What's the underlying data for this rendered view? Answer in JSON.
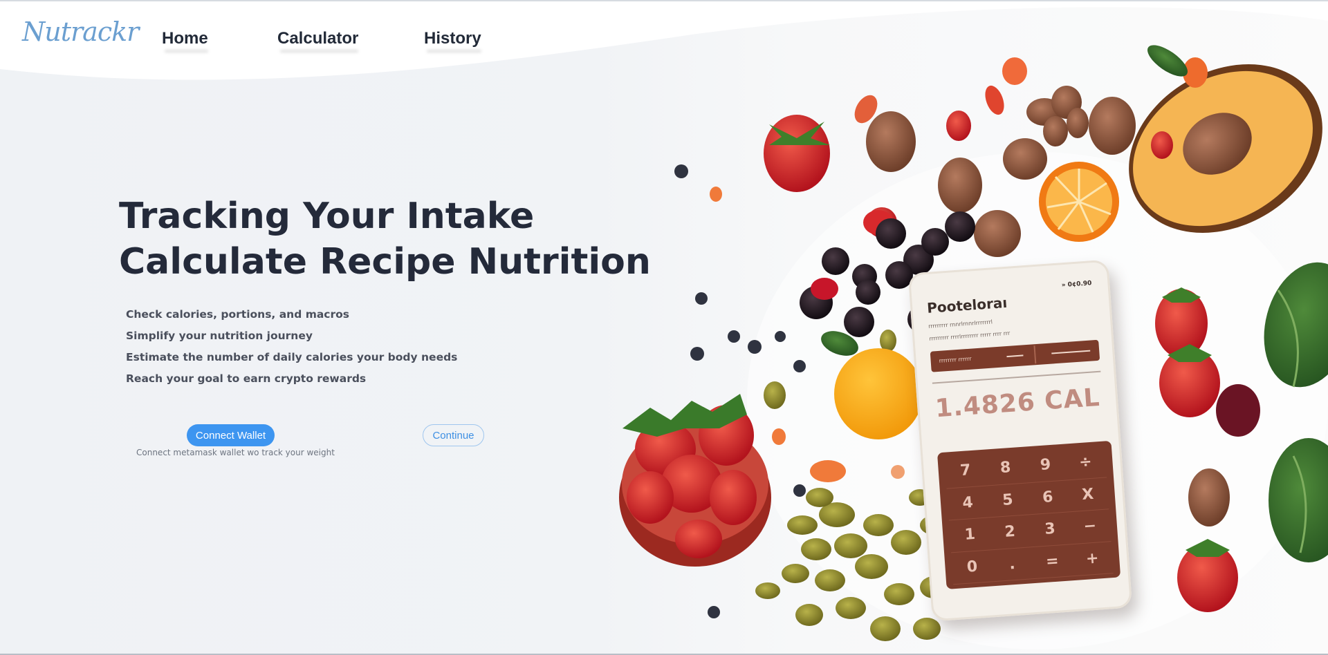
{
  "logo": {
    "text": "Nutrackr"
  },
  "nav": {
    "items": [
      {
        "label": "Home"
      },
      {
        "label": "Calculator"
      },
      {
        "label": "History"
      }
    ]
  },
  "hero": {
    "title_line1": "Tracking Your Intake",
    "title_line2": "Calculate Recipe Nutrition",
    "features": [
      "Check calories, portions, and macros",
      "Simplify your nutrition journey",
      "Estimate the number of daily calories your body needs",
      "Reach your goal to earn crypto rewards"
    ]
  },
  "actions": {
    "connect_label": "Connect Wallet",
    "continue_label": "Continue",
    "connect_hint": "Connect metamask wallet wo track your weight"
  },
  "illustration": {
    "phone_title": "Pooteloraı",
    "phone_corner": "» 0¢0.90",
    "phone_sub1": "rrrrrrrrr rnnrlrnnrlrrrrrrrl",
    "phone_sub2": "rrrrrrrrr rrrrlrrrrrrrr rrrrr rrrr rrr",
    "phone_bar_label": "rrrrrrrr rrrrrr",
    "display": "1.4826 CAL",
    "keys": [
      "7",
      "8",
      "9",
      "÷",
      "4",
      "5",
      "6",
      "X",
      "1",
      "2",
      "3",
      "−",
      "0",
      ".",
      "=",
      "+"
    ]
  },
  "colors": {
    "accent": "#3d95f0",
    "heading": "#242a3a",
    "body_text": "#4a4f5c",
    "logo": "#6b9fd0",
    "keypad": "#7a3b2b"
  }
}
